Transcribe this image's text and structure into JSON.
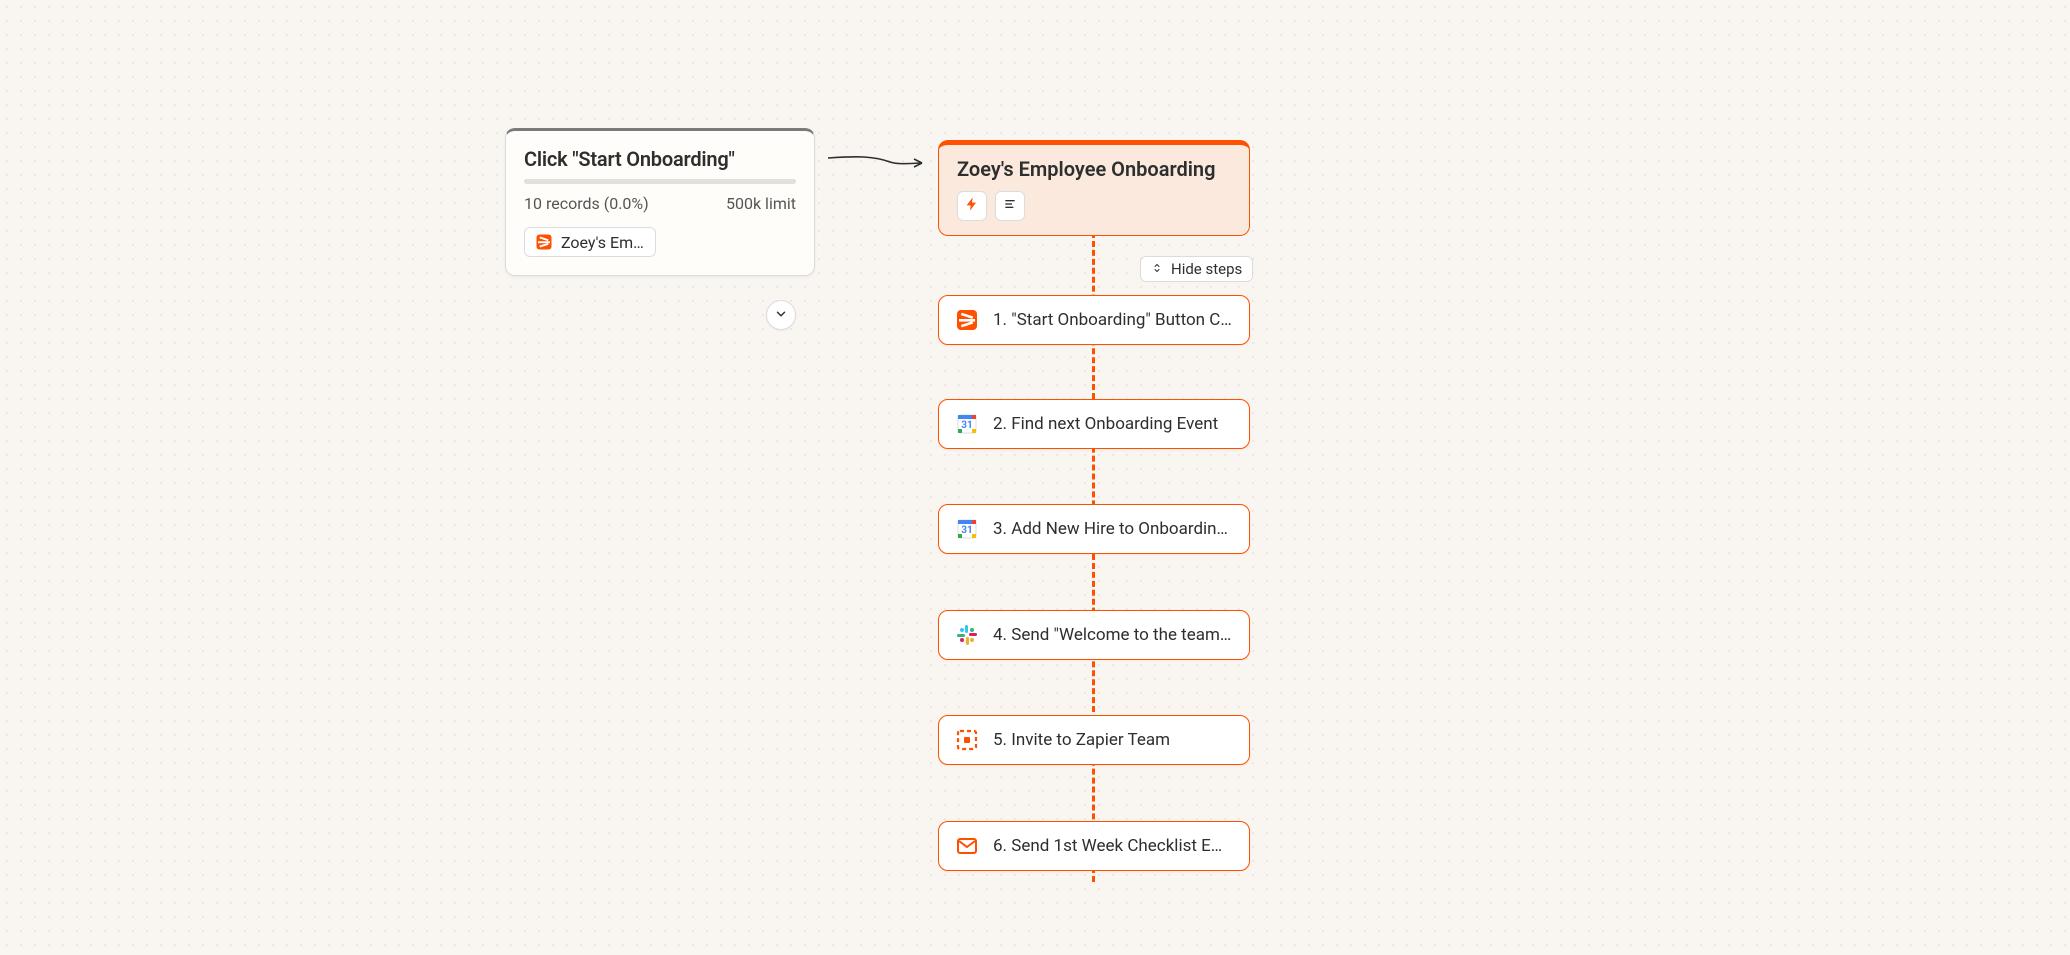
{
  "left_card": {
    "title": "Click \"Start Onboarding\"",
    "records": "10 records (0.0%)",
    "limit": "500k limit",
    "chip_label": "Zoey's Emp…"
  },
  "zap": {
    "title": "Zoey's Employee Onboarding",
    "hide_steps_label": "Hide steps",
    "steps": [
      {
        "icon": "zapier",
        "label": "1. \"Start Onboarding\" Button C…"
      },
      {
        "icon": "gcal",
        "label": "2. Find next Onboarding Event"
      },
      {
        "icon": "gcal",
        "label": "3. Add New Hire to Onboardin…"
      },
      {
        "icon": "slack",
        "label": "4. Send \"Welcome to the team…"
      },
      {
        "icon": "zapier-o",
        "label": "5. Invite to Zapier Team"
      },
      {
        "icon": "mail",
        "label": "6. Send 1st Week Checklist E…"
      }
    ]
  }
}
